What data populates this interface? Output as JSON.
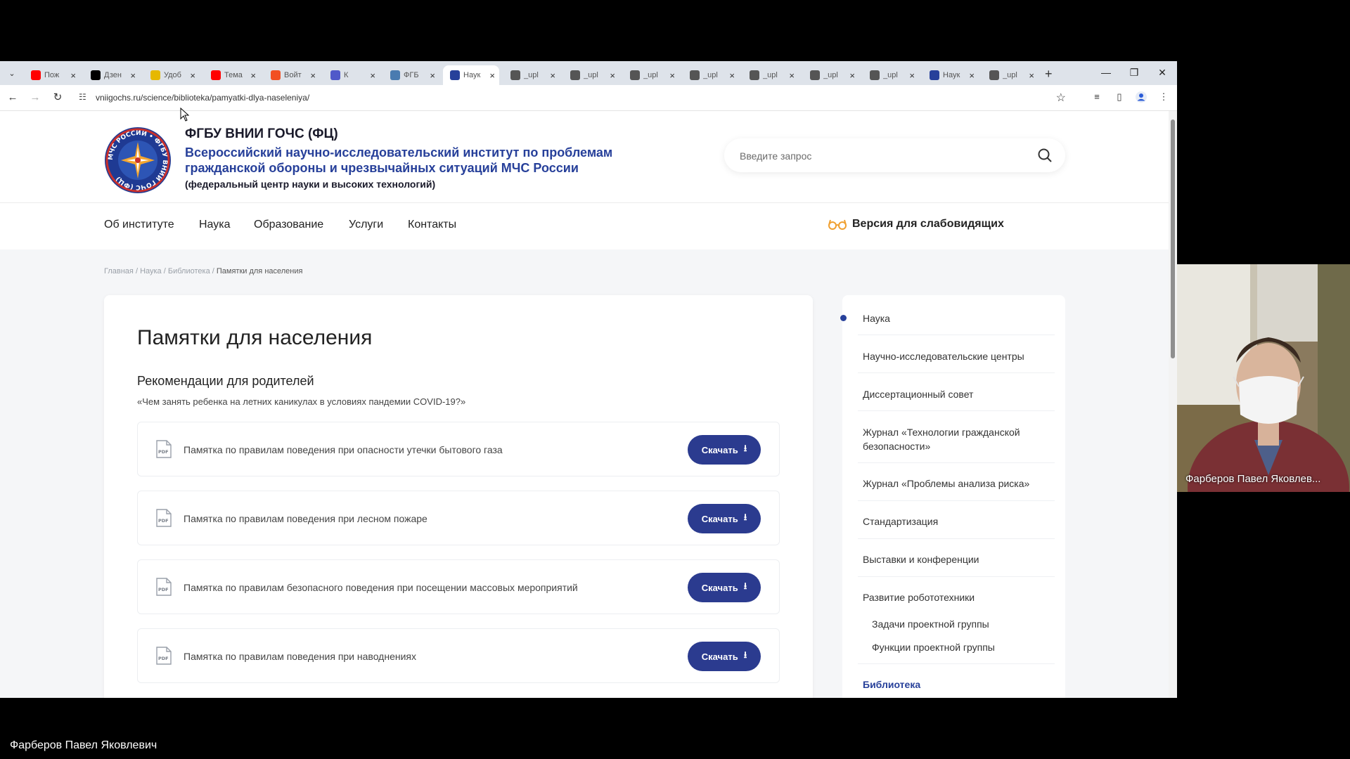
{
  "browser": {
    "tabs": [
      {
        "title": "Пож",
        "favicon": "youtube-icon",
        "color": "#ff0000"
      },
      {
        "title": "Дзен",
        "favicon": "dzen-icon",
        "color": "#000000"
      },
      {
        "title": "Удоб",
        "favicon": "heart-icon",
        "color": "#e6b800"
      },
      {
        "title": "Тема",
        "favicon": "youtube-icon",
        "color": "#ff0000"
      },
      {
        "title": "Войт",
        "favicon": "microsoft-icon",
        "color": "#f25022"
      },
      {
        "title": "К",
        "favicon": "teams-icon",
        "color": "#5059c9"
      },
      {
        "title": "ФГБ",
        "favicon": "site-icon",
        "color": "#4a7bb0"
      },
      {
        "title": "Наук",
        "favicon": "site-icon",
        "color": "#27409a"
      },
      {
        "title": "_upl",
        "favicon": "globe-icon",
        "color": "#555555"
      },
      {
        "title": "_upl",
        "favicon": "globe-icon",
        "color": "#555555"
      },
      {
        "title": "_upl",
        "favicon": "globe-icon",
        "color": "#555555"
      },
      {
        "title": "_upl",
        "favicon": "globe-icon",
        "color": "#555555"
      },
      {
        "title": "_upl",
        "favicon": "globe-icon",
        "color": "#555555"
      },
      {
        "title": "_upl",
        "favicon": "globe-icon",
        "color": "#555555"
      },
      {
        "title": "_upl",
        "favicon": "globe-icon",
        "color": "#555555"
      },
      {
        "title": "Наук",
        "favicon": "site-icon",
        "color": "#27409a"
      },
      {
        "title": "_upl",
        "favicon": "globe-icon",
        "color": "#555555"
      }
    ],
    "active_tab": 7,
    "url": "vniigochs.ru/science/biblioteka/pamyatki-dlya-naseleniya/"
  },
  "site": {
    "logo_text": "МЧС РОССИИ • ФГБУ ВНИИ ГОЧС (ФЦ)",
    "org_short": "ФГБУ ВНИИ ГОЧС (ФЦ)",
    "org_long": "Всероссийский научно-исследовательский институт по проблемам гражданской обороны и чрезвычайных ситуаций МЧС России",
    "org_sub": "(федеральный центр науки и высоких технологий)",
    "search_placeholder": "Введите запрос",
    "nav": [
      "Об институте",
      "Наука",
      "Образование",
      "Услуги",
      "Контакты"
    ],
    "a11y_label": "Версия для слабовидящих",
    "accent_color": "#27409a",
    "button_color": "#2b3b8f"
  },
  "breadcrumb": {
    "items": [
      "Главная",
      "Наука",
      "Библиотека"
    ],
    "current": "Памятки для населения",
    "separator": "/"
  },
  "content": {
    "title": "Памятки для населения",
    "section_title": "Рекомендации для родителей",
    "section_sub": "«Чем занять ребенка на летних каникулах в условиях пандемии COVID-19?»",
    "download_label": "Скачать",
    "documents": [
      "Памятка по правилам поведения при опасности утечки бытового газа",
      "Памятка по правилам поведения при лесном пожаре",
      "Памятка по правилам безопасного поведения при посещении массовых мероприятий",
      "Памятка по правилам поведения при наводнениях"
    ]
  },
  "sidebar": {
    "items": [
      "Наука",
      "Научно-исследовательские центры",
      "Диссертационный совет",
      "Журнал «Технологии гражданской безопасности»",
      "Журнал «Проблемы анализа риска»",
      "Стандартизация",
      "Выставки и конференции",
      "Развитие робототехники"
    ],
    "subitems": [
      "Задачи проектной группы",
      "Функции проектной группы"
    ],
    "active_section": "Библиотека"
  },
  "video_call": {
    "participant_tile_name": "Фарберов Павел Яковлев...",
    "bottom_name": "Фарберов Павел Яковлевич"
  }
}
